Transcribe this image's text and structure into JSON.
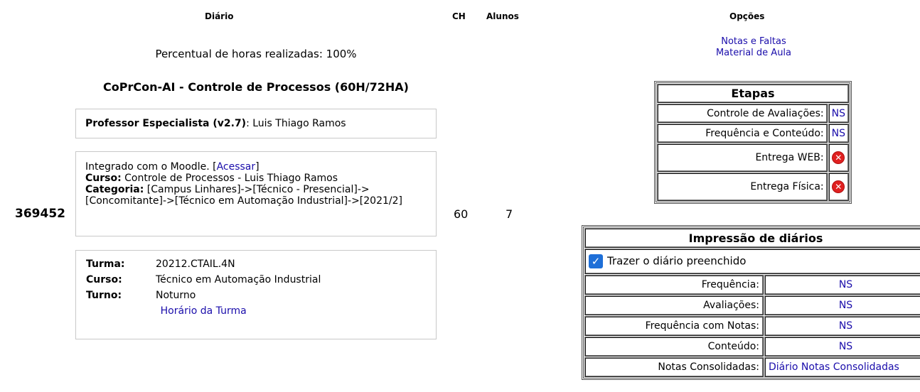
{
  "headers": {
    "diario": "Diário",
    "ch": "CH",
    "alunos": "Alunos",
    "opcoes": "Opções"
  },
  "percentual": "Percentual de horas realizadas: 100%",
  "disciplina": "CoPrCon-AI - Controle de Processos (60H/72HA)",
  "professor": {
    "label": "Professor Especialista (v2.7)",
    "name": ": Luis Thiago Ramos"
  },
  "moodle": {
    "prefix": "Integrado com o Moodle. [",
    "link": "Acessar",
    "suffix": "]",
    "curso_label": "Curso:",
    "curso_value": " Controle de Processos - Luis Thiago Ramos",
    "categoria_label": "Categoria:",
    "categoria_value": " [Campus Linhares]->[Técnico - Presencial]->[Concomitante]->[Técnico em Automação Industrial]->[2021/2]"
  },
  "diario_id": "369452",
  "ch_value": "60",
  "alunos_value": "7",
  "turma": {
    "turma_label": "Turma:",
    "turma_value": "20212.CTAIL.4N",
    "curso_label": "Curso:",
    "curso_value": "Técnico em Automação Industrial",
    "turno_label": "Turno:",
    "turno_value": "Noturno",
    "horario_link": "Horário da Turma"
  },
  "opcoes_links": {
    "notas_faltas": "Notas e Faltas",
    "material": "Material de Aula"
  },
  "etapas": {
    "title": "Etapas",
    "rows": [
      {
        "label": "Controle de Avaliações:",
        "value": "NS"
      },
      {
        "label": "Frequência e Conteúdo:",
        "value": "NS"
      },
      {
        "label": "Entrega WEB:",
        "icon": "x-circle-icon"
      },
      {
        "label": "Entrega Física:",
        "icon": "x-circle-icon"
      }
    ]
  },
  "impressao": {
    "title": "Impressão de diários",
    "checkbox_label": "Trazer o diário preenchido",
    "checked": true,
    "rows": [
      {
        "label": "Frequência:",
        "value": "NS"
      },
      {
        "label": "Avaliações:",
        "value": "NS"
      },
      {
        "label": "Frequência com Notas:",
        "value": "NS"
      },
      {
        "label": "Conteúdo:",
        "value": "NS"
      },
      {
        "label": "Notas Consolidadas:",
        "value": "Diário Notas Consolidadas"
      }
    ]
  },
  "colors": {
    "link": "#1a0dab",
    "error_icon": "#e02020",
    "checkbox": "#1e6fd8"
  }
}
